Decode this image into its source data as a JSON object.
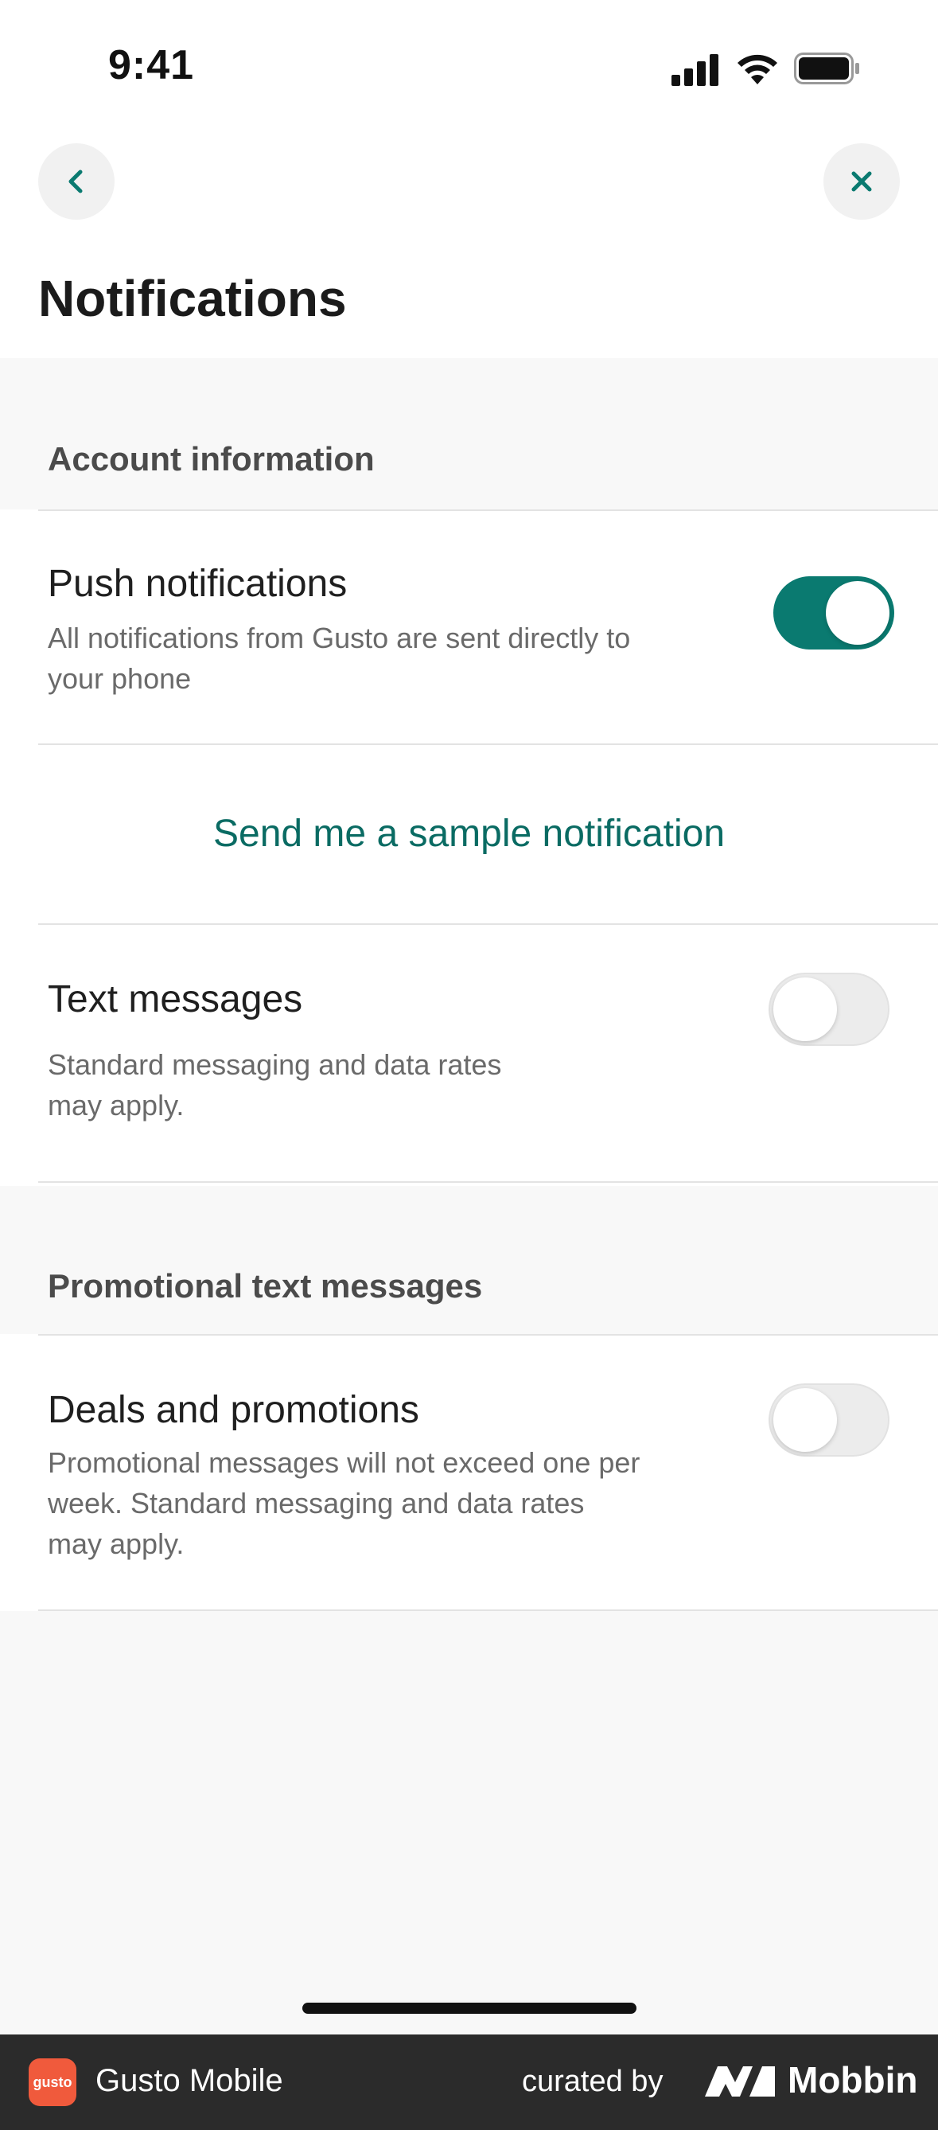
{
  "status_bar": {
    "time": "9:41"
  },
  "header": {
    "title": "Notifications"
  },
  "sections": {
    "account": {
      "title": "Account information"
    },
    "promotional": {
      "title": "Promotional text messages"
    }
  },
  "rows": {
    "push": {
      "title": "Push notifications",
      "desc_line1": "All notifications from Gusto are sent directly to",
      "desc_line2": "your phone",
      "enabled": true
    },
    "sample": {
      "label": "Send me a sample notification"
    },
    "text": {
      "title": "Text messages",
      "desc_line1": "Standard messaging and data rates",
      "desc_line2": "may apply.",
      "enabled": false
    },
    "deals": {
      "title": "Deals and promotions",
      "desc_line1": "Promotional messages will not exceed one per",
      "desc_line2": "week. Standard messaging and data rates",
      "desc_line3": "may apply.",
      "enabled": false
    }
  },
  "footer": {
    "app_icon_text": "gusto",
    "app_name": "Gusto Mobile",
    "curated_by": "curated by",
    "brand": "Mobbin"
  },
  "colors": {
    "accent": "#0a7a70",
    "link": "#0a6b63",
    "footer_bg": "#2b2b2b",
    "app_icon": "#f05a3c"
  }
}
